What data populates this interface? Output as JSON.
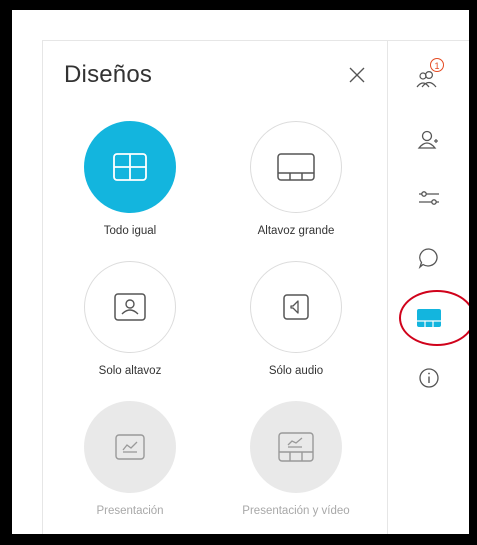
{
  "panel": {
    "title": "Diseños",
    "close_icon": "close-icon"
  },
  "layouts": [
    {
      "label": "Todo igual",
      "icon": "grid-layout-icon",
      "state": "selected"
    },
    {
      "label": "Altavoz grande",
      "icon": "prominent-layout-icon",
      "state": "normal"
    },
    {
      "label": "Solo altavoz",
      "icon": "speaker-only-icon",
      "state": "normal"
    },
    {
      "label": "Sólo audio",
      "icon": "audio-only-icon",
      "state": "normal"
    },
    {
      "label": "Presentación",
      "icon": "presentation-icon",
      "state": "disabled"
    },
    {
      "label": "Presentación y vídeo",
      "icon": "presentation-video-icon",
      "state": "disabled"
    }
  ],
  "sidebar": {
    "participants_badge": "1",
    "items": [
      {
        "icon": "participants-icon"
      },
      {
        "icon": "add-user-icon"
      },
      {
        "icon": "settings-sliders-icon"
      },
      {
        "icon": "chat-icon"
      },
      {
        "icon": "layout-icon",
        "active": true
      },
      {
        "icon": "info-icon"
      }
    ]
  },
  "colors": {
    "accent": "#13b5de",
    "highlight_ring": "#d0021b",
    "badge": "#e44a22"
  }
}
